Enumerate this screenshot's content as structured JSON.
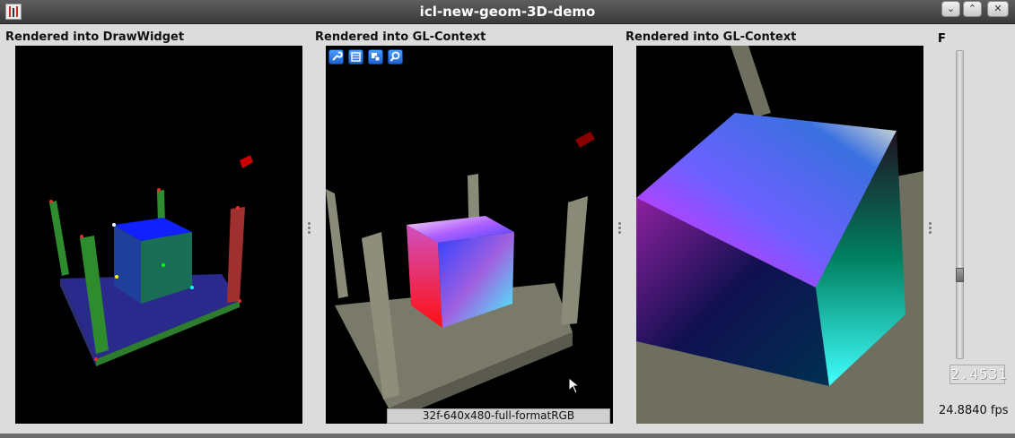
{
  "window": {
    "title": "icl-new-geom-3D-demo",
    "buttons": [
      "minimize",
      "maximize",
      "close"
    ]
  },
  "panels": [
    {
      "label": "Rendered into DrawWidget"
    },
    {
      "label": "Rendered into GL-Context"
    },
    {
      "label": "Rendered into GL-Context"
    }
  ],
  "toolbar_icons": [
    "wrench-icon",
    "list-icon",
    "layers-icon",
    "zoom-icon"
  ],
  "format_label": "32f-640x480-full-formatRGB",
  "side": {
    "label": "F",
    "lcd_value": "2.4531",
    "fps": "24.8840 fps",
    "slider_fraction": 0.74
  }
}
